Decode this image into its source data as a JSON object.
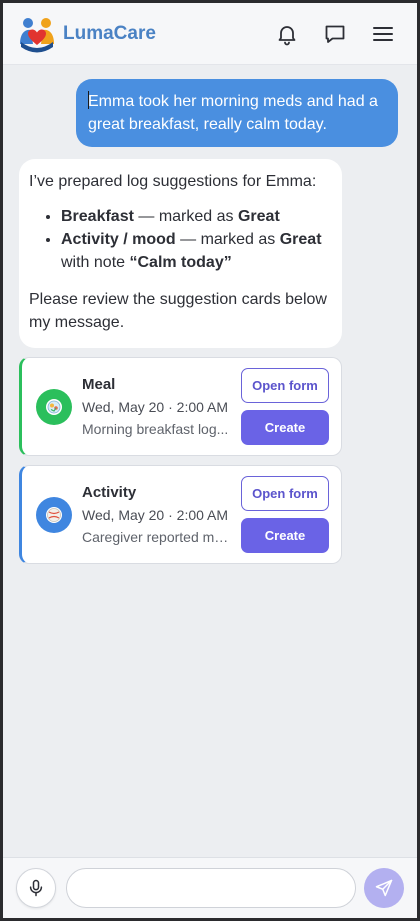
{
  "app": {
    "name": "LumaCare"
  },
  "header": {
    "icons": [
      "logo-icon",
      "bell-icon",
      "chat-icon",
      "menu-icon"
    ]
  },
  "messages": {
    "user": {
      "text": "Emma took her morning meds and had a great breakfast, really calm today."
    },
    "assistant": {
      "intro": "I’ve prepared log suggestions for Emma:",
      "items": [
        {
          "label": "Breakfast",
          "middle": " — marked as ",
          "value": "Great",
          "tail": "",
          "note": ""
        },
        {
          "label": "Activity / mood",
          "middle": " — marked as ",
          "value": "Great",
          "tail": " with note ",
          "note": "“Calm today”"
        }
      ],
      "outro": "Please review the suggestion cards below my message."
    }
  },
  "cards": [
    {
      "type": "Meal",
      "date": "Wed, May 20 · 2:00 AM",
      "description": "Morning breakfast log...",
      "icon": "meal-icon",
      "accent": "#2bbf5c",
      "open_label": "Open form",
      "create_label": "Create"
    },
    {
      "type": "Activity",
      "date": "Wed, May 20 · 2:00 AM",
      "description": "Caregiver reported mo...",
      "icon": "activity-icon",
      "accent": "#3f86e0",
      "open_label": "Open form",
      "create_label": "Create"
    }
  ],
  "composer": {
    "input_value": "",
    "placeholder": "",
    "mic_icon": "microphone-icon",
    "send_icon": "send-icon"
  },
  "colors": {
    "brand": "#4a82c4",
    "user_bubble": "#4a8fe0",
    "primary_button": "#6a63e6",
    "send_button_disabled": "#b3b0f0"
  }
}
